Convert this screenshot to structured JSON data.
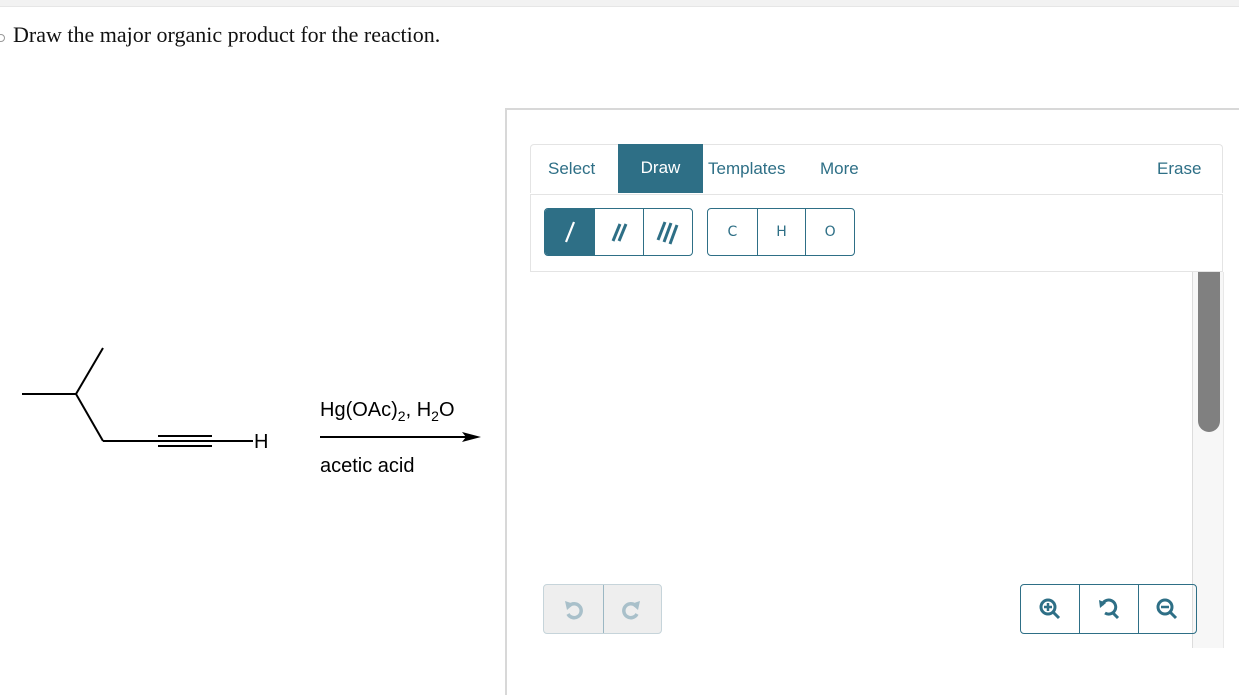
{
  "prompt": "Draw the major organic product for the reaction.",
  "reaction": {
    "reagent_top": {
      "main": "Hg(OAc)",
      "sub1": "2",
      "mid": ", H",
      "sub2": "2",
      "end": "O"
    },
    "reagent_bottom": "acetic acid",
    "terminal_atom": "H"
  },
  "editor": {
    "tabs": [
      {
        "label": "Select",
        "active": false
      },
      {
        "label": "Draw",
        "active": true
      },
      {
        "label": "Templates",
        "active": false
      },
      {
        "label": "More",
        "active": false
      }
    ],
    "erase_label": "Erase",
    "bond_tools": [
      "single-bond-icon",
      "double-bond-icon",
      "triple-bond-icon"
    ],
    "atoms": [
      "C",
      "H",
      "O"
    ],
    "history_buttons": [
      "undo-icon",
      "redo-icon"
    ],
    "zoom_buttons": [
      "zoom-in-icon",
      "zoom-reset-icon",
      "zoom-out-icon"
    ],
    "accent_color": "#2e6f86"
  }
}
